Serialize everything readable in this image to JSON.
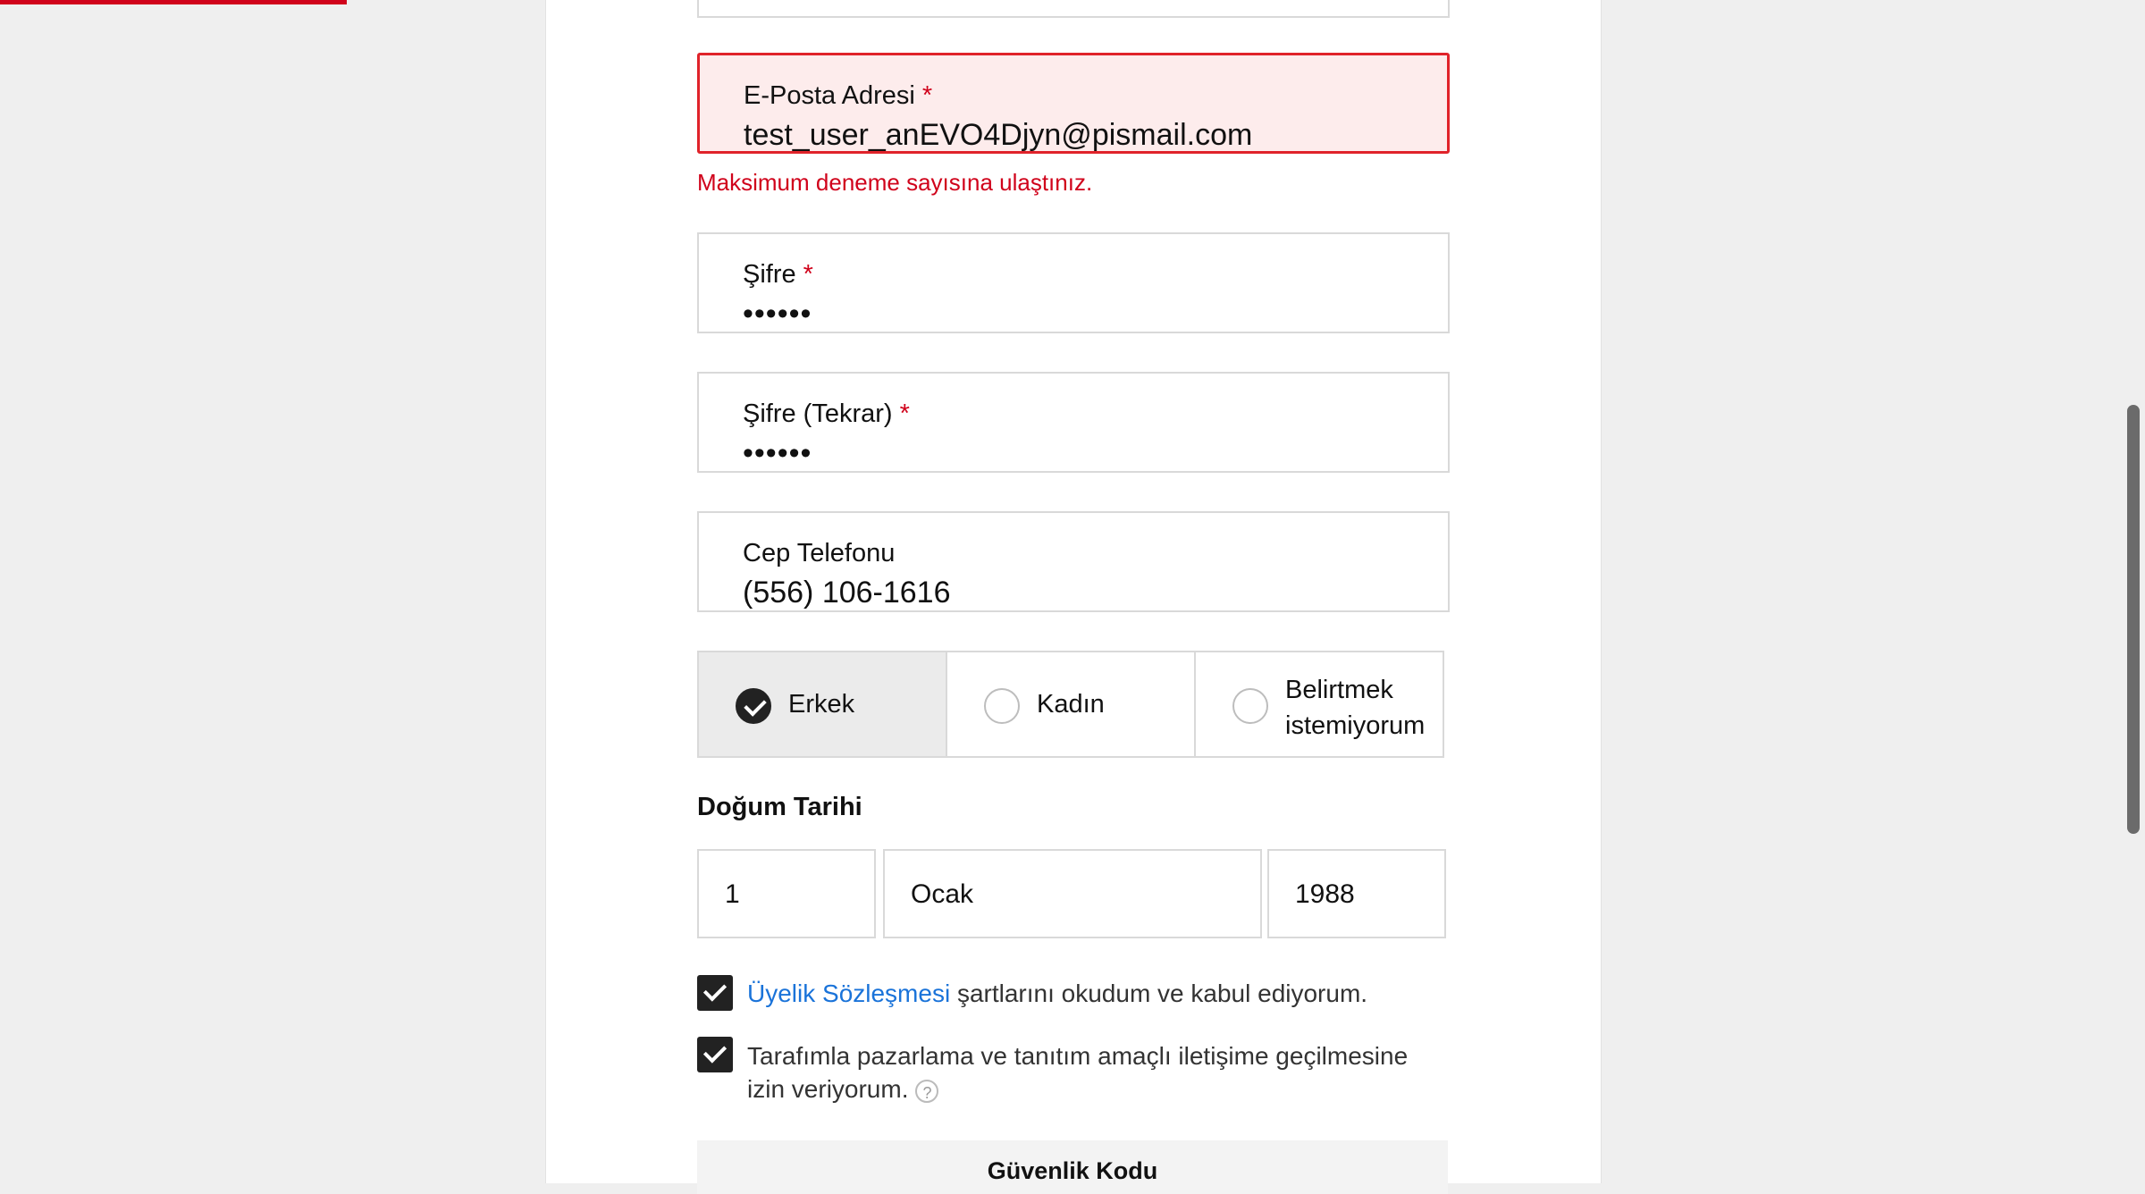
{
  "form": {
    "email": {
      "label": "E-Posta Adresi",
      "required_mark": "*",
      "value": "test_user_anEVO4Djyn@pismail.com",
      "error": "Maksimum deneme sayısına ulaştınız."
    },
    "password": {
      "label": "Şifre",
      "required_mark": "*",
      "value": "••••••"
    },
    "password_repeat": {
      "label": "Şifre (Tekrar)",
      "required_mark": "*",
      "value": "••••••"
    },
    "phone": {
      "label": "Cep Telefonu",
      "value": "(556) 106-1616"
    },
    "gender": {
      "options": [
        {
          "label": "Erkek",
          "selected": true
        },
        {
          "label": "Kadın",
          "selected": false
        },
        {
          "label_line1": "Belirtmek",
          "label_line2": "istemiyorum",
          "selected": false
        }
      ]
    },
    "birth_date": {
      "title": "Doğum Tarihi",
      "day": "1",
      "month": "Ocak",
      "year": "1988"
    },
    "agreements": {
      "membership_link": "Üyelik Sözleşmesi",
      "membership_text": " şartlarını okudum ve kabul ediyorum.",
      "membership_checked": true,
      "marketing_text": "Tarafımla pazarlama ve tanıtım amaçlı iletişime geçilmesine izin veriyorum.",
      "marketing_help": "?",
      "marketing_checked": true
    },
    "security_code": {
      "title": "Güvenlik Kodu"
    }
  },
  "colors": {
    "error": "#d0021b",
    "link": "#1a73d9",
    "checkbox": "#222222",
    "error_bg": "#fdecec"
  }
}
